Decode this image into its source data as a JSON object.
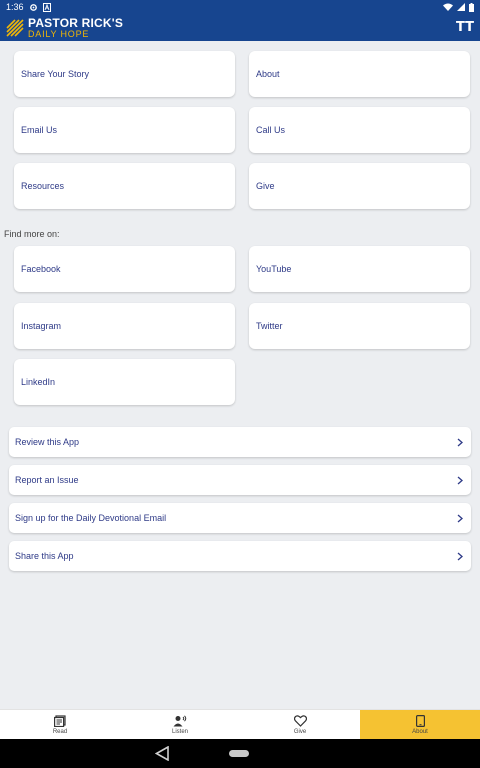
{
  "status_bar": {
    "time": "1:36",
    "icons": [
      "settings-icon",
      "notification-a-icon",
      "wifi-icon",
      "signal-icon",
      "battery-icon"
    ]
  },
  "header": {
    "logo_line1": "PASTOR RICK'S",
    "logo_line2": "DAILY HOPE",
    "text_size_label": "TT"
  },
  "tiles": {
    "share_story": "Share Your Story",
    "about": "About",
    "email_us": "Email Us",
    "call_us": "Call Us",
    "resources": "Resources",
    "give": "Give"
  },
  "social": {
    "heading": "Find more on:",
    "facebook": "Facebook",
    "youtube": "YouTube",
    "instagram": "Instagram",
    "twitter": "Twitter",
    "linkedin": "LinkedIn"
  },
  "actions": [
    {
      "label": "Review this App"
    },
    {
      "label": "Report an Issue"
    },
    {
      "label": "Sign up for the Daily Devotional Email"
    },
    {
      "label": "Share this App"
    }
  ],
  "bottom_nav": [
    {
      "label": "Read",
      "icon": "book-icon"
    },
    {
      "label": "Listen",
      "icon": "listen-icon"
    },
    {
      "label": "Give",
      "icon": "heart-icon"
    },
    {
      "label": "About",
      "icon": "phone-icon",
      "active": true
    }
  ],
  "colors": {
    "header_bg": "#17458f",
    "logo_accent": "#f2b705",
    "link_text": "#2e3a87",
    "active_tab": "#f5c232",
    "page_bg": "#eceef1"
  }
}
